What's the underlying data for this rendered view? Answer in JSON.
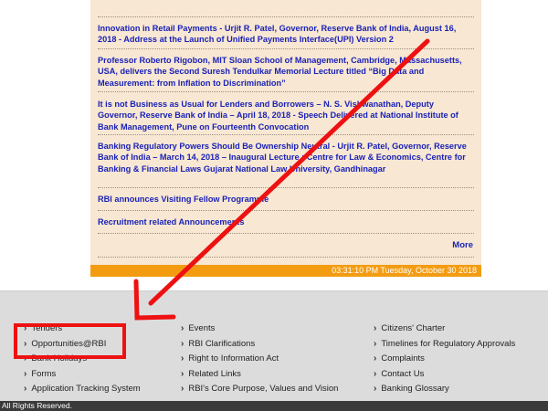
{
  "news": {
    "items": [
      {
        "text": "Innovation in Retail Payments - Urjit R. Patel, Governor, Reserve Bank of India, August 16, 2018 - Address at the Launch of Unified Payments Interface(UPI) Version 2"
      },
      {
        "text": "Professor Roberto Rigobon, MIT Sloan School of Management, Cambridge, Massachusetts, USA, delivers the Second Suresh Tendulkar Memorial Lecture titled “Big Data and Measurement: from Inflation to Discrimination”"
      },
      {
        "text": "It is not Business as Usual for Lenders and Borrowers – N. S. Vishwanathan, Deputy Governor, Reserve Bank of India – April 18, 2018 - Speech Delivered at National Institute of Bank Management, Pune on Fourteenth Convocation"
      },
      {
        "text": "Banking Regulatory Powers Should Be Ownership Neutral - Urjit R. Patel, Governor, Reserve Bank of India – March 14, 2018 – Inaugural Lecture : Centre for Law & Economics, Centre for Banking & Financial Laws Gujarat National Law University, Gandhinagar"
      },
      {
        "text": "RBI announces Visiting Fellow Programme"
      },
      {
        "text": "Recruitment related Announcements"
      }
    ],
    "more_label": "More",
    "clock": "03:31:10 PM Tuesday, October 30 2018"
  },
  "footer": {
    "col1": [
      "Tenders",
      "Opportunities@RBI",
      "Bank Holidays",
      "Forms",
      "Application Tracking System"
    ],
    "col2": [
      "Events",
      "RBI Clarifications",
      "Right to Information Act",
      "Related Links",
      "RBI's Core Purpose, Values and Vision"
    ],
    "col3": [
      "Citizens' Charter",
      "Timelines for Regulatory Approvals",
      "Complaints",
      "Contact Us",
      "Banking Glossary"
    ],
    "copyright": "All Rights Reserved."
  },
  "colors": {
    "panel_bg": "#f8e7d2",
    "link": "#1a22b8",
    "clock_bar": "#f39c12",
    "annotation_red": "#ee1111",
    "footer_bg": "#dcdcdc"
  }
}
